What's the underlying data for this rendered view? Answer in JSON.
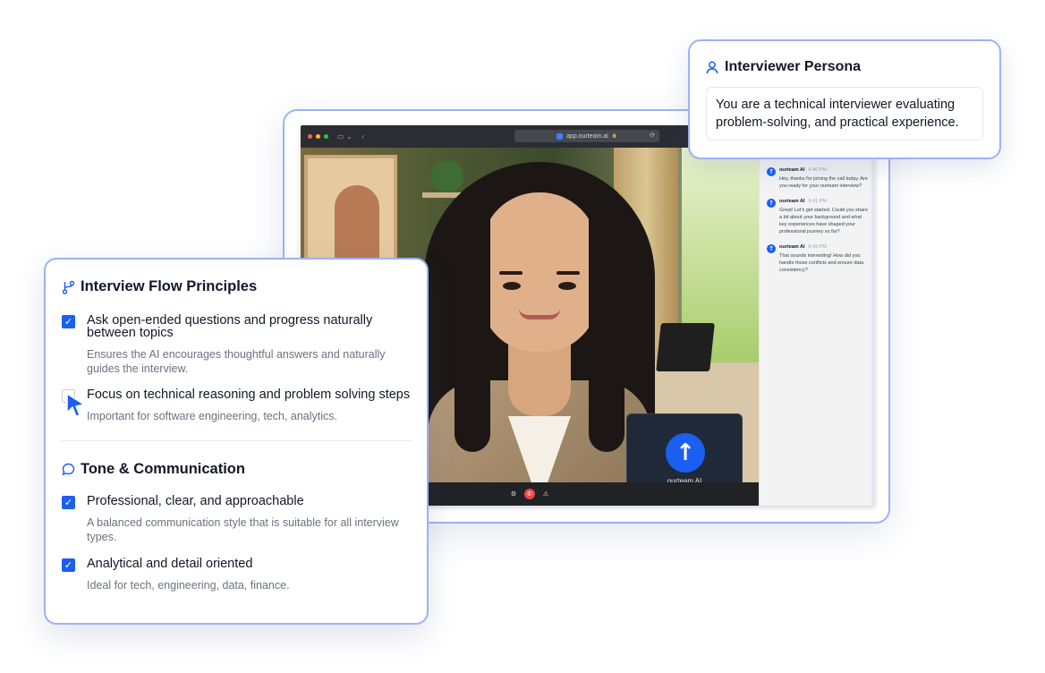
{
  "browser": {
    "url": "app.ourteam.ai",
    "url_lock": "🔒",
    "refresh_icon": "⟳",
    "traffic_lights": [
      "#ff5f57",
      "#febc2e",
      "#28c840"
    ],
    "sidebar_icon": "▭ ⌄",
    "back_icon": "‹"
  },
  "video": {
    "ai_tile_label": "ourteam AI",
    "ai_avatar_glyph": "↑",
    "controls": {
      "settings_icon": "⚙",
      "end_call_icon": "✆",
      "report_icon": "⚠"
    }
  },
  "chat": {
    "messages": [
      {
        "sender": "ourteam AI",
        "time": "6:40 PM",
        "text": "Hey, thanks for joining the call today. Are you ready for your ourteam interview?"
      },
      {
        "sender": "ourteam AI",
        "time": "6:41 PM",
        "text": "Great! Let's get started. Could you share a bit about your background and what key experiences have shaped your professional journey so far?"
      },
      {
        "sender": "ourteam AI",
        "time": "6:43 PM",
        "text": "That sounds interesting! How did you handle those conflicts and ensure data consistency?"
      }
    ]
  },
  "persona": {
    "title": "Interviewer Persona",
    "text": "You are a technical interviewer evaluating problem-solving, and practical experience."
  },
  "principles": {
    "flow_title": "Interview Flow Principles",
    "flow_items": [
      {
        "title": "Ask open-ended questions and progress naturally between topics",
        "desc": "Ensures the AI encourages thoughtful answers and naturally guides the interview.",
        "checked": true
      },
      {
        "title": "Focus on technical reasoning and problem solving steps",
        "desc": "Important for software engineering, tech, analytics.",
        "checked": false
      }
    ],
    "tone_title": "Tone & Communication",
    "tone_items": [
      {
        "title": "Professional, clear, and approachable",
        "desc": "A balanced communication style that is suitable for all interview types.",
        "checked": true
      },
      {
        "title": "Analytical and detail oriented",
        "desc": "Ideal for tech, engineering, data, finance.",
        "checked": true
      }
    ],
    "check_glyph": "✓"
  },
  "colors": {
    "accent": "#1a5ff0",
    "card_border": "#9db2f3",
    "end_call": "#ef4444"
  }
}
